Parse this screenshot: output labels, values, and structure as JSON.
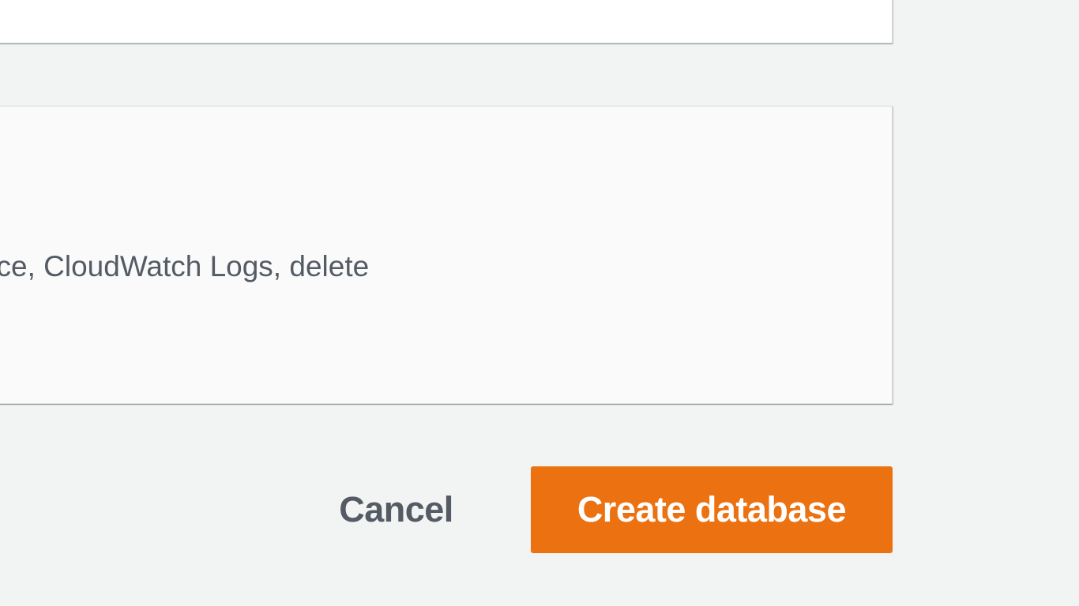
{
  "panel": {
    "description_fragment": "ed, maintenance, CloudWatch Logs, delete"
  },
  "actions": {
    "cancel_label": "Cancel",
    "primary_label": "Create database"
  }
}
